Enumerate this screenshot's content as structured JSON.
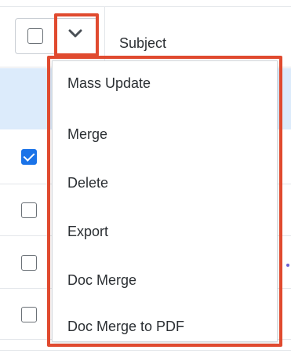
{
  "header": {
    "subject_label": "Subject"
  },
  "menu": {
    "items": [
      {
        "label": "Mass Update"
      },
      {
        "label": "Merge"
      },
      {
        "label": "Delete"
      },
      {
        "label": "Export"
      },
      {
        "label": "Doc Merge"
      },
      {
        "label": "Doc Merge to PDF"
      }
    ]
  },
  "rows": [
    {
      "checked": true
    },
    {
      "checked": false
    },
    {
      "checked": false
    },
    {
      "checked": false
    },
    {
      "checked": false
    }
  ],
  "colors": {
    "highlight_outline": "#e04a2f",
    "selected_row": "#dcebfb",
    "checkbox_checked": "#1a73e8"
  },
  "icons": {
    "chevron": "chevron-down-icon"
  }
}
